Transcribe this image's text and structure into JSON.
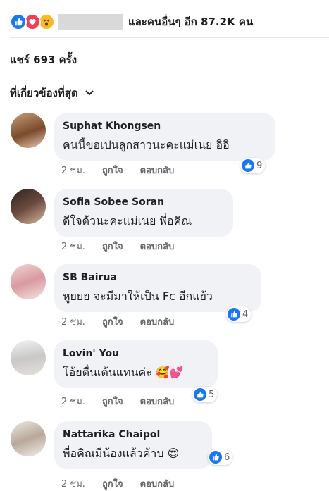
{
  "reactions_bar": {
    "icons": [
      "like-icon",
      "love-icon",
      "wow-icon"
    ],
    "summary": "และคนอื่นๆ อีก 87.2K คน"
  },
  "shares": "แชร์ 693 ครั้ง",
  "sort": {
    "label": "ที่เกี่ยวข้องที่สุด"
  },
  "comments": [
    {
      "name": "Suphat Khongsen",
      "text": "คนนี้ขอเปนลูกสาวนะคะแม่เนย อิอิ",
      "time": "2 ชม.",
      "like": "ถูกใจ",
      "reply": "ตอบกลับ",
      "reaction_count": "9"
    },
    {
      "name": "Sofia Sobee Soran",
      "text": "ดีใจด้วนะคะแม่เนย พี่อคิณ",
      "time": "2 ชม.",
      "like": "ถูกใจ",
      "reply": "ตอบกลับ",
      "reaction_count": ""
    },
    {
      "name": "SB Bairua",
      "text": "หูยยย จะมีมาให้เป็น Fc อีกแย้ว",
      "time": "2 ชม.",
      "like": "ถูกใจ",
      "reply": "ตอบกลับ",
      "reaction_count": "4"
    },
    {
      "name": "Lovin' You",
      "text": "โอ้ยตื่นเต้นแทนค่ะ",
      "emoji": "🥰💕",
      "time": "2 ชม.",
      "like": "ถูกใจ",
      "reply": "ตอบกลับ",
      "reaction_count": "5"
    },
    {
      "name": "Nattarika Chaipol",
      "text": "พี่อคิณมีน้องแล้วค้าบ",
      "emoji": "😍",
      "time": "2 ชม.",
      "like": "ถูกใจ",
      "reply": "ตอบกลับ",
      "reaction_count": "6"
    }
  ],
  "colors": {
    "like": "#1877f2",
    "love": "#f33e58",
    "wow": "#f7b928",
    "bubble": "#f0f2f5",
    "meta": "#65676b"
  }
}
